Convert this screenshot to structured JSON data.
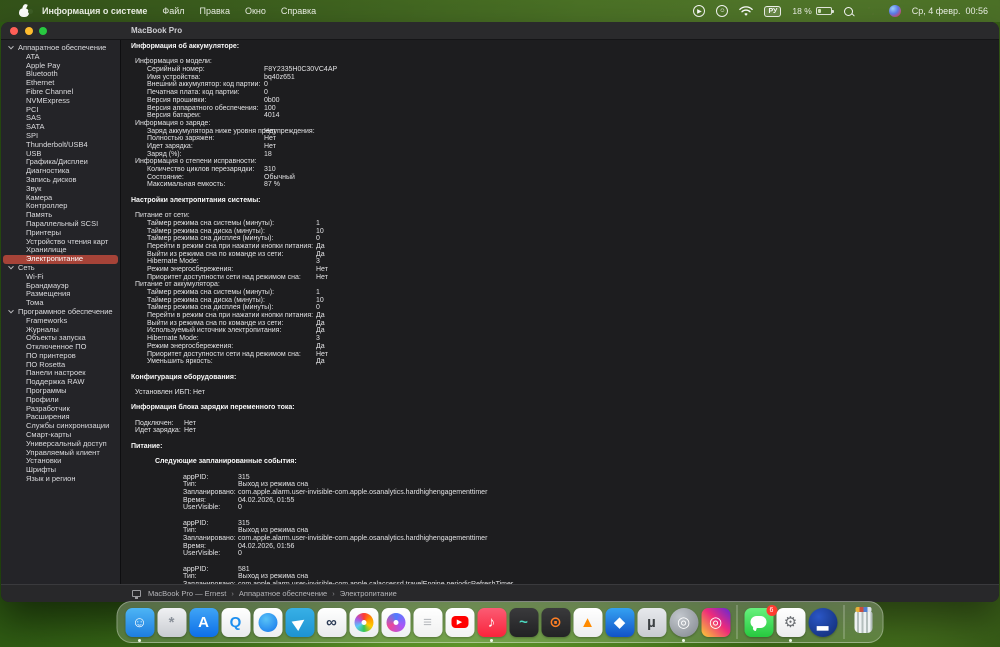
{
  "menu_bar": {
    "app_name": "Информация о системе",
    "menus": [
      "Файл",
      "Правка",
      "Окно",
      "Справка"
    ],
    "status": {
      "keyboard": "РУ",
      "battery": "18 %",
      "clock": "Ср, 4 февр.  00:56"
    }
  },
  "window": {
    "title": "MacBook Pro",
    "status_bar": {
      "crumbs": [
        "MacBook Pro — Ernest",
        "Аппаратное обеспечение",
        "Электропитание"
      ],
      "separator": "›"
    }
  },
  "sidebar": {
    "selected": "Электропитание",
    "sections": [
      {
        "label": "Аппаратное обеспечение",
        "items": [
          "ATA",
          "Apple Pay",
          "Bluetooth",
          "Ethernet",
          "Fibre Channel",
          "NVMExpress",
          "PCI",
          "SAS",
          "SATA",
          "SPI",
          "Thunderbolt/USB4",
          "USB",
          "Графика/Дисплеи",
          "Диагностика",
          "Запись дисков",
          "Звук",
          "Камера",
          "Контроллер",
          "Память",
          "Параллельный SCSI",
          "Принтеры",
          "Устройство чтения карт",
          "Хранилище",
          "Электропитание"
        ]
      },
      {
        "label": "Сеть",
        "items": [
          "Wi-Fi",
          "Брандмауэр",
          "Размещения",
          "Тома"
        ]
      },
      {
        "label": "Программное обеспечение",
        "items": [
          "Frameworks",
          "Журналы",
          "Объекты запуска",
          "Отключенное ПО",
          "ПО принтеров",
          "ПО Rosetta",
          "Панели настроек",
          "Поддержка RAW",
          "Программы",
          "Профили",
          "Разработчик",
          "Расширения",
          "Службы синхронизации",
          "Смарт-карты",
          "Универсальный доступ",
          "Управляемый клиент",
          "Установки",
          "Шрифты",
          "Язык и регион"
        ]
      }
    ]
  },
  "content": {
    "lines": [
      [
        "title",
        "Информация об аккумуляторе:"
      ],
      [
        "blank"
      ],
      [
        "group",
        "Информация о модели:"
      ],
      [
        "row-a",
        "Серийный номер:",
        "F8Y2335H0C30VC4AP"
      ],
      [
        "row-a",
        "Имя устройства:",
        "bq40z651"
      ],
      [
        "row-a",
        "Внешний аккумулятор: код партии:",
        "0"
      ],
      [
        "row-a",
        "Печатная плата: код партии:",
        "0"
      ],
      [
        "row-a",
        "Версия прошивки:",
        "0b00"
      ],
      [
        "row-a",
        "Версия аппаратного обеспечения:",
        "100"
      ],
      [
        "row-a",
        "Версия батареи:",
        "4014"
      ],
      [
        "group",
        "Информация о заряде:"
      ],
      [
        "row-a",
        "Заряд аккумулятора ниже уровня предупреждения:",
        "Нет"
      ],
      [
        "row-a",
        "Полностью заряжен:",
        "Нет"
      ],
      [
        "row-a",
        "Идет зарядка:",
        "Нет"
      ],
      [
        "row-a",
        "Заряд (%):",
        "18"
      ],
      [
        "group",
        "Информация о степени исправности:"
      ],
      [
        "row-a",
        "Количество циклов перезарядки:",
        "310"
      ],
      [
        "row-a",
        "Состояние:",
        "Обычный"
      ],
      [
        "row-a",
        "Максимальная емкость:",
        "87 %"
      ],
      [
        "blank"
      ],
      [
        "title",
        "Настройки электропитания системы:"
      ],
      [
        "blank"
      ],
      [
        "group",
        "Питание от сети:"
      ],
      [
        "row-b",
        "Таймер режима сна системы (минуты):",
        "1"
      ],
      [
        "row-b",
        "Таймер режима сна диска (минуты):",
        "10"
      ],
      [
        "row-b",
        "Таймер режима сна дисплея (минуты):",
        "0"
      ],
      [
        "row-b",
        "Перейти в режим сна при нажатии кнопки питания:",
        "Да"
      ],
      [
        "row-b",
        "Выйти из режима сна по команде из сети:",
        "Да"
      ],
      [
        "row-b",
        "Hibernate Mode:",
        "3"
      ],
      [
        "row-b",
        "Режим энергосбережения:",
        "Нет"
      ],
      [
        "row-b",
        "Приоритет доступности сети над режимом сна:",
        "Нет"
      ],
      [
        "group",
        "Питание от аккумулятора:"
      ],
      [
        "row-b",
        "Таймер режима сна системы (минуты):",
        "1"
      ],
      [
        "row-b",
        "Таймер режима сна диска (минуты):",
        "10"
      ],
      [
        "row-b",
        "Таймер режима сна дисплея (минуты):",
        "0"
      ],
      [
        "row-b",
        "Перейти в режим сна при нажатии кнопки питания:",
        "Да"
      ],
      [
        "row-b",
        "Выйти из режима сна по команде из сети:",
        "Да"
      ],
      [
        "row-b",
        "Используемый источник электропитания:",
        "Да"
      ],
      [
        "row-b",
        "Hibernate Mode:",
        "3"
      ],
      [
        "row-b",
        "Режим энергосбережения:",
        "Да"
      ],
      [
        "row-b",
        "Приоритет доступности сети над режимом сна:",
        "Нет"
      ],
      [
        "row-b",
        "Уменьшить яркость:",
        "Да"
      ],
      [
        "blank"
      ],
      [
        "title",
        "Конфигурация оборудования:"
      ],
      [
        "blank"
      ],
      [
        "cfg",
        "Установлен ИБП:",
        "Нет"
      ],
      [
        "blank"
      ],
      [
        "title",
        "Информация блока зарядки переменного тока:"
      ],
      [
        "blank"
      ],
      [
        "ac",
        "Подключен:",
        "Нет"
      ],
      [
        "ac",
        "Идет зарядка:",
        "Нет"
      ],
      [
        "blank"
      ],
      [
        "title",
        "Питание:"
      ],
      [
        "blank"
      ],
      [
        "events-head",
        "Следующие запланированные события:"
      ],
      [
        "blank"
      ],
      [
        "event",
        "appPID:",
        "315"
      ],
      [
        "event",
        "Тип:",
        "Выход из режима сна"
      ],
      [
        "event",
        "Запланировано:",
        "com.apple.alarm.user-invisible-com.apple.osanalytics.hardhighengagementtimer"
      ],
      [
        "event",
        "Время:",
        "04.02.2026, 01:55"
      ],
      [
        "event",
        "UserVisible:",
        "0"
      ],
      [
        "blank"
      ],
      [
        "event",
        "appPID:",
        "315"
      ],
      [
        "event",
        "Тип:",
        "Выход из режима сна"
      ],
      [
        "event",
        "Запланировано:",
        "com.apple.alarm.user-invisible-com.apple.osanalytics.hardhighengagementtimer"
      ],
      [
        "event",
        "Время:",
        "04.02.2026, 01:56"
      ],
      [
        "event",
        "UserVisible:",
        "0"
      ],
      [
        "blank"
      ],
      [
        "event",
        "appPID:",
        "581"
      ],
      [
        "event",
        "Тип:",
        "Выход из режима сна"
      ],
      [
        "event",
        "Запланировано:",
        "com.apple.alarm.user-invisible-com.apple.calaccessd.travelEngine.periodicRefreshTimer"
      ]
    ]
  },
  "dock": {
    "icons": [
      {
        "name": "finder",
        "bg": "linear-gradient(180deg,#4db5f5,#1e7de0)",
        "fg": "#ffffff",
        "glyph": "☺",
        "running": true
      },
      {
        "name": "pinwheel-utility",
        "bg": "linear-gradient(180deg,#f0f1f3,#c9ccd1)",
        "fg": "#8a9099",
        "glyph": "*"
      },
      {
        "name": "app-store",
        "bg": "linear-gradient(180deg,#3fa4f6,#0d6fe8)",
        "fg": "#ffffff",
        "glyph": "A"
      },
      {
        "name": "quicktime",
        "bg": "linear-gradient(180deg,#ffffff,#e9eaec)",
        "fg": "#1d8ff0",
        "glyph": "Q"
      },
      {
        "name": "safari",
        "bg": "linear-gradient(180deg,#ffffff,#eceef0)",
        "shape": "disc",
        "disc": "radial-gradient(circle at 40% 32%,#59c3f7,#1273eb)"
      },
      {
        "name": "telegram",
        "bg": "linear-gradient(180deg,#37b0e6,#1d93d2)",
        "fg": "#ffffff",
        "glyph": "▶",
        "rot": -35
      },
      {
        "name": "binoculars-app",
        "bg": "linear-gradient(180deg,#ffffff,#e9eaec)",
        "fg": "#2b3a55",
        "glyph": "∞"
      },
      {
        "name": "photos",
        "bg": "linear-gradient(180deg,#ffffff,#eceef0)",
        "shape": "disc",
        "white_center": true,
        "disc": "conic-gradient(#ff3b30,#ff9500,#ffcc00,#34c759,#5ac8fa,#af52de,#ff3b30)"
      },
      {
        "name": "copilot",
        "bg": "linear-gradient(180deg,#ffffff,#eef0f2)",
        "shape": "disc",
        "white_center": true,
        "disc": "conic-gradient(#4f7cff,#a855f7,#ec4899,#4f7cff)"
      },
      {
        "name": "notes",
        "bg": "linear-gradient(180deg,#ffffff,#f0f0f0)",
        "fg": "#b9bcc0",
        "glyph": "≡"
      },
      {
        "name": "youtube",
        "bg": "linear-gradient(180deg,#ffffff,#f2f2f2)",
        "shape": "yt"
      },
      {
        "name": "apple-music",
        "bg": "linear-gradient(180deg,#fb5c74,#fa233b)",
        "fg": "#ffffff",
        "glyph": "♪",
        "running": true
      },
      {
        "name": "activity-monitor",
        "bg": "linear-gradient(180deg,#3a3a3c,#222224)",
        "fg": "#4cd9c0",
        "glyph": "~"
      },
      {
        "name": "blender",
        "bg": "linear-gradient(180deg,#3a3a3c,#232325)",
        "fg": "#ff7f24",
        "glyph": "⊙"
      },
      {
        "name": "vlc",
        "bg": "linear-gradient(180deg,#ffffff,#ededef)",
        "fg": "#ff8a00",
        "glyph": "▲"
      },
      {
        "name": "bluestacks",
        "bg": "linear-gradient(180deg,#34a1f2,#1253c8)",
        "fg": "#ffffff",
        "glyph": "◆"
      },
      {
        "name": "utorrent",
        "bg": "linear-gradient(180deg,#e7e9ec,#c9ccd1)",
        "fg": "#3c4043",
        "glyph": "µ"
      },
      {
        "name": "wheel-app",
        "bg": "radial-gradient(circle at 35% 30%,#c2c7cd,#82878e)",
        "fg": "#ffffff",
        "glyph": "◎",
        "round": true,
        "running": true
      },
      {
        "name": "instagram",
        "bg": "linear-gradient(45deg,#f9ce34,#ee2a7b 55%,#6228d7)",
        "fg": "#ffffff",
        "glyph": "◎"
      },
      {
        "sep": true
      },
      {
        "name": "messages",
        "bg": "linear-gradient(180deg,#67f27d,#27c93f)",
        "shape": "bubble",
        "badge": "6"
      },
      {
        "name": "lamp-app",
        "bg": "linear-gradient(180deg,#ffffff,#ececee)",
        "fg": "#6a6d72",
        "glyph": "⚙",
        "running": true
      },
      {
        "name": "blue-round-app",
        "bg": "radial-gradient(circle at 35% 30%,#2a56c6,#102a6e)",
        "fg": "#ffffff",
        "glyph": "▂",
        "round": true
      },
      {
        "sep": true
      },
      {
        "name": "trash",
        "trash": true
      }
    ]
  },
  "colors": {
    "sidebar_selected": "#a64338",
    "menu_bar_green": "#3e5e26",
    "badge_red": "#ff3b30"
  }
}
